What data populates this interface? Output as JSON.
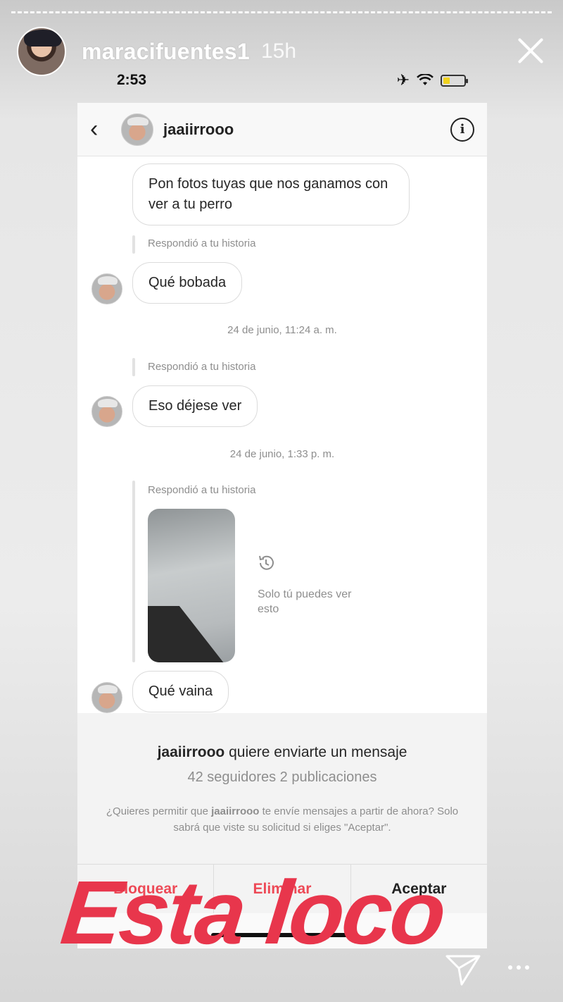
{
  "story": {
    "username": "maracifuentes1",
    "time_ago": "15h",
    "overlay_text": "Esta loco",
    "overlay_color": "#e8364c"
  },
  "phone": {
    "clock": "2:53"
  },
  "dm": {
    "contact_name": "jaaiirrooo",
    "messages": {
      "m1": "Pon fotos tuyas que nos ganamos con ver a tu perro",
      "reply_label_1": "Respondió a tu historia",
      "m2": "Qué bobada",
      "timestamp_1": "24 de junio, 11:24 a. m.",
      "reply_label_2": "Respondió a tu historia",
      "m3": "Eso déjese ver",
      "timestamp_2": "24 de junio, 1:33 p. m.",
      "reply_label_3": "Respondió a tu historia",
      "only_you": "Solo tú puedes ver esto",
      "m4": "Qué vaina"
    }
  },
  "request": {
    "title_name": "jaaiirrooo",
    "title_rest": " quiere enviarte un mensaje",
    "stats": "42 seguidores 2 publicaciones",
    "desc_prefix": "¿Quieres permitir que ",
    "desc_name": "jaaiirrooo",
    "desc_suffix": " te envíe mensajes a partir de ahora? Solo sabrá que viste su solicitud si eliges \"Aceptar\"."
  },
  "actions": {
    "block": "Bloquear",
    "delete": "Eliminar",
    "accept": "Aceptar"
  }
}
